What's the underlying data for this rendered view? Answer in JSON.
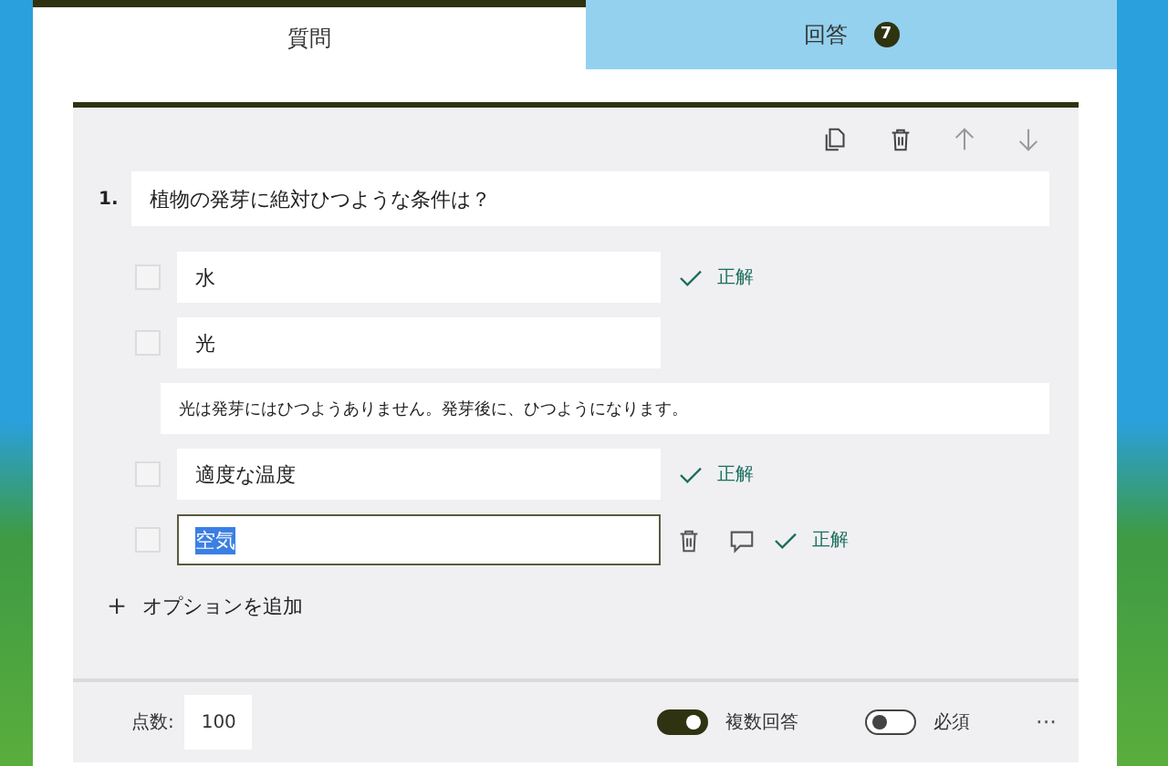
{
  "tabs": [
    {
      "label": "質問",
      "selected": true
    },
    {
      "label": "回答",
      "selected": false,
      "badge": "7"
    }
  ],
  "question": {
    "number": "1.",
    "text": "植物の発芽に絶対ひつような条件は？",
    "options": [
      {
        "text": "水",
        "checked": false,
        "correct": true,
        "correct_label": "正解",
        "focused": false
      },
      {
        "text": "光",
        "checked": false,
        "correct": false,
        "focused": false,
        "feedback": "光は発芽にはひつようありません。発芽後に、ひつようになります。"
      },
      {
        "text": "適度な温度",
        "checked": false,
        "correct": true,
        "correct_label": "正解",
        "focused": false
      },
      {
        "text": "空気",
        "checked": false,
        "correct": true,
        "correct_label": "正解",
        "focused": true
      }
    ],
    "add_option": {
      "icon": "＋",
      "label": "オプションを追加"
    }
  },
  "footer": {
    "points_label": "点数:",
    "points_value": "100",
    "toggles": [
      {
        "label": "複数回答",
        "on": true
      },
      {
        "label": "必須",
        "on": false
      }
    ],
    "more": "···"
  }
}
